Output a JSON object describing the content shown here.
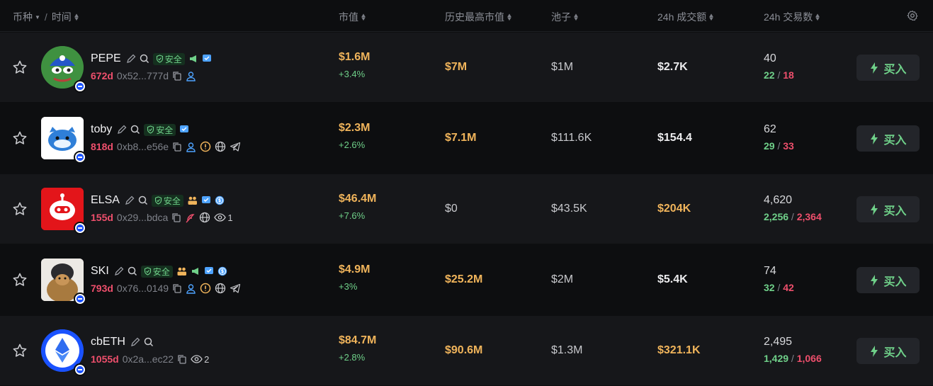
{
  "header": {
    "coin_label": "币种",
    "separator": "/",
    "time_label": "时间",
    "market_cap_label": "市值",
    "ath_label": "历史最高市值",
    "pool_label": "池子",
    "volume_label": "24h 成交额",
    "txns_label": "24h 交易数"
  },
  "colors": {
    "background": "#0d0e10",
    "row_alt": "#16171a",
    "gold": "#f0b45b",
    "green": "#6fd089",
    "red": "#ee4f6c",
    "chain_blue": "#1a52ff"
  },
  "rows": [
    {
      "name": "PEPE",
      "safe_label": "安全",
      "age": "672d",
      "address": "0x52...777d",
      "watchers": "",
      "market_cap": "$1.6M",
      "change": "+3.4%",
      "ath": "$7M",
      "pool": "$1M",
      "volume": "$2.7K",
      "txns": "40",
      "buys": "22",
      "sells": "18",
      "buy_label": "买入"
    },
    {
      "name": "toby",
      "safe_label": "安全",
      "age": "818d",
      "address": "0xb8...e56e",
      "watchers": "",
      "market_cap": "$2.3M",
      "change": "+2.6%",
      "ath": "$7.1M",
      "pool": "$111.6K",
      "volume": "$154.4",
      "txns": "62",
      "buys": "29",
      "sells": "33",
      "buy_label": "买入"
    },
    {
      "name": "ELSA",
      "safe_label": "安全",
      "age": "155d",
      "address": "0x29...bdca",
      "watchers": "1",
      "market_cap": "$46.4M",
      "change": "+7.6%",
      "ath": "$0",
      "pool": "$43.5K",
      "volume": "$204K",
      "txns": "4,620",
      "buys": "2,256",
      "sells": "2,364",
      "buy_label": "买入"
    },
    {
      "name": "SKI",
      "safe_label": "安全",
      "age": "793d",
      "address": "0x76...0149",
      "watchers": "",
      "market_cap": "$4.9M",
      "change": "+3%",
      "ath": "$25.2M",
      "pool": "$2M",
      "volume": "$5.4K",
      "txns": "74",
      "buys": "32",
      "sells": "42",
      "buy_label": "买入"
    },
    {
      "name": "cbETH",
      "safe_label": "",
      "age": "1055d",
      "address": "0x2a...ec22",
      "watchers": "2",
      "market_cap": "$84.7M",
      "change": "+2.8%",
      "ath": "$90.6M",
      "pool": "$1.3M",
      "volume": "$321.1K",
      "txns": "2,495",
      "buys": "1,429",
      "sells": "1,066",
      "buy_label": "买入"
    }
  ]
}
